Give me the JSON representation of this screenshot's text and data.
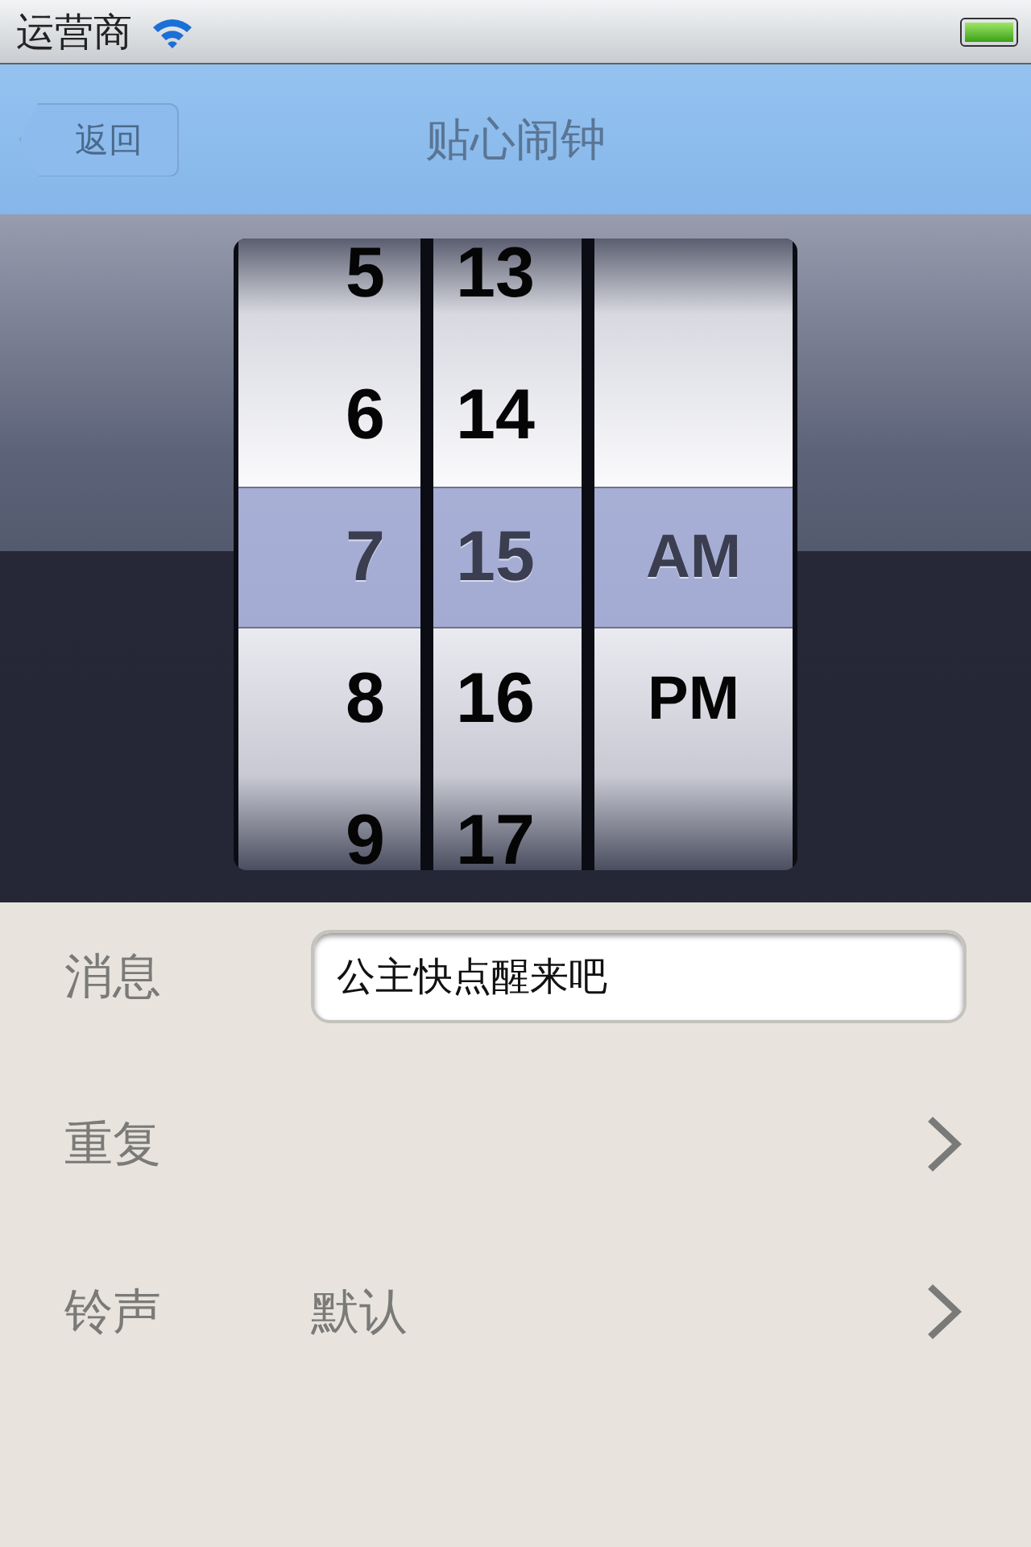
{
  "status_bar": {
    "carrier": "运营商"
  },
  "nav_bar": {
    "back_button": "返回",
    "title": "贴心闹钟"
  },
  "picker": {
    "columns": [
      {
        "kind": "hour",
        "items": [
          {
            "label": "5",
            "selected": false
          },
          {
            "label": "6",
            "selected": false
          },
          {
            "label": "7",
            "selected": true
          },
          {
            "label": "8",
            "selected": false
          },
          {
            "label": "9",
            "selected": false
          }
        ]
      },
      {
        "kind": "minute",
        "items": [
          {
            "label": "13",
            "selected": false
          },
          {
            "label": "14",
            "selected": false
          },
          {
            "label": "15",
            "selected": true
          },
          {
            "label": "16",
            "selected": false
          },
          {
            "label": "17",
            "selected": false
          }
        ]
      },
      {
        "kind": "period",
        "items": [
          {
            "label": "AM",
            "selected": true
          },
          {
            "label": "PM",
            "selected": false
          }
        ]
      }
    ]
  },
  "form": {
    "rows": [
      {
        "kind": "text",
        "label": "消息",
        "value": "公主快点醒来吧"
      },
      {
        "kind": "link",
        "label": "重复"
      },
      {
        "kind": "link",
        "label": "铃声",
        "value": "默认"
      }
    ]
  }
}
